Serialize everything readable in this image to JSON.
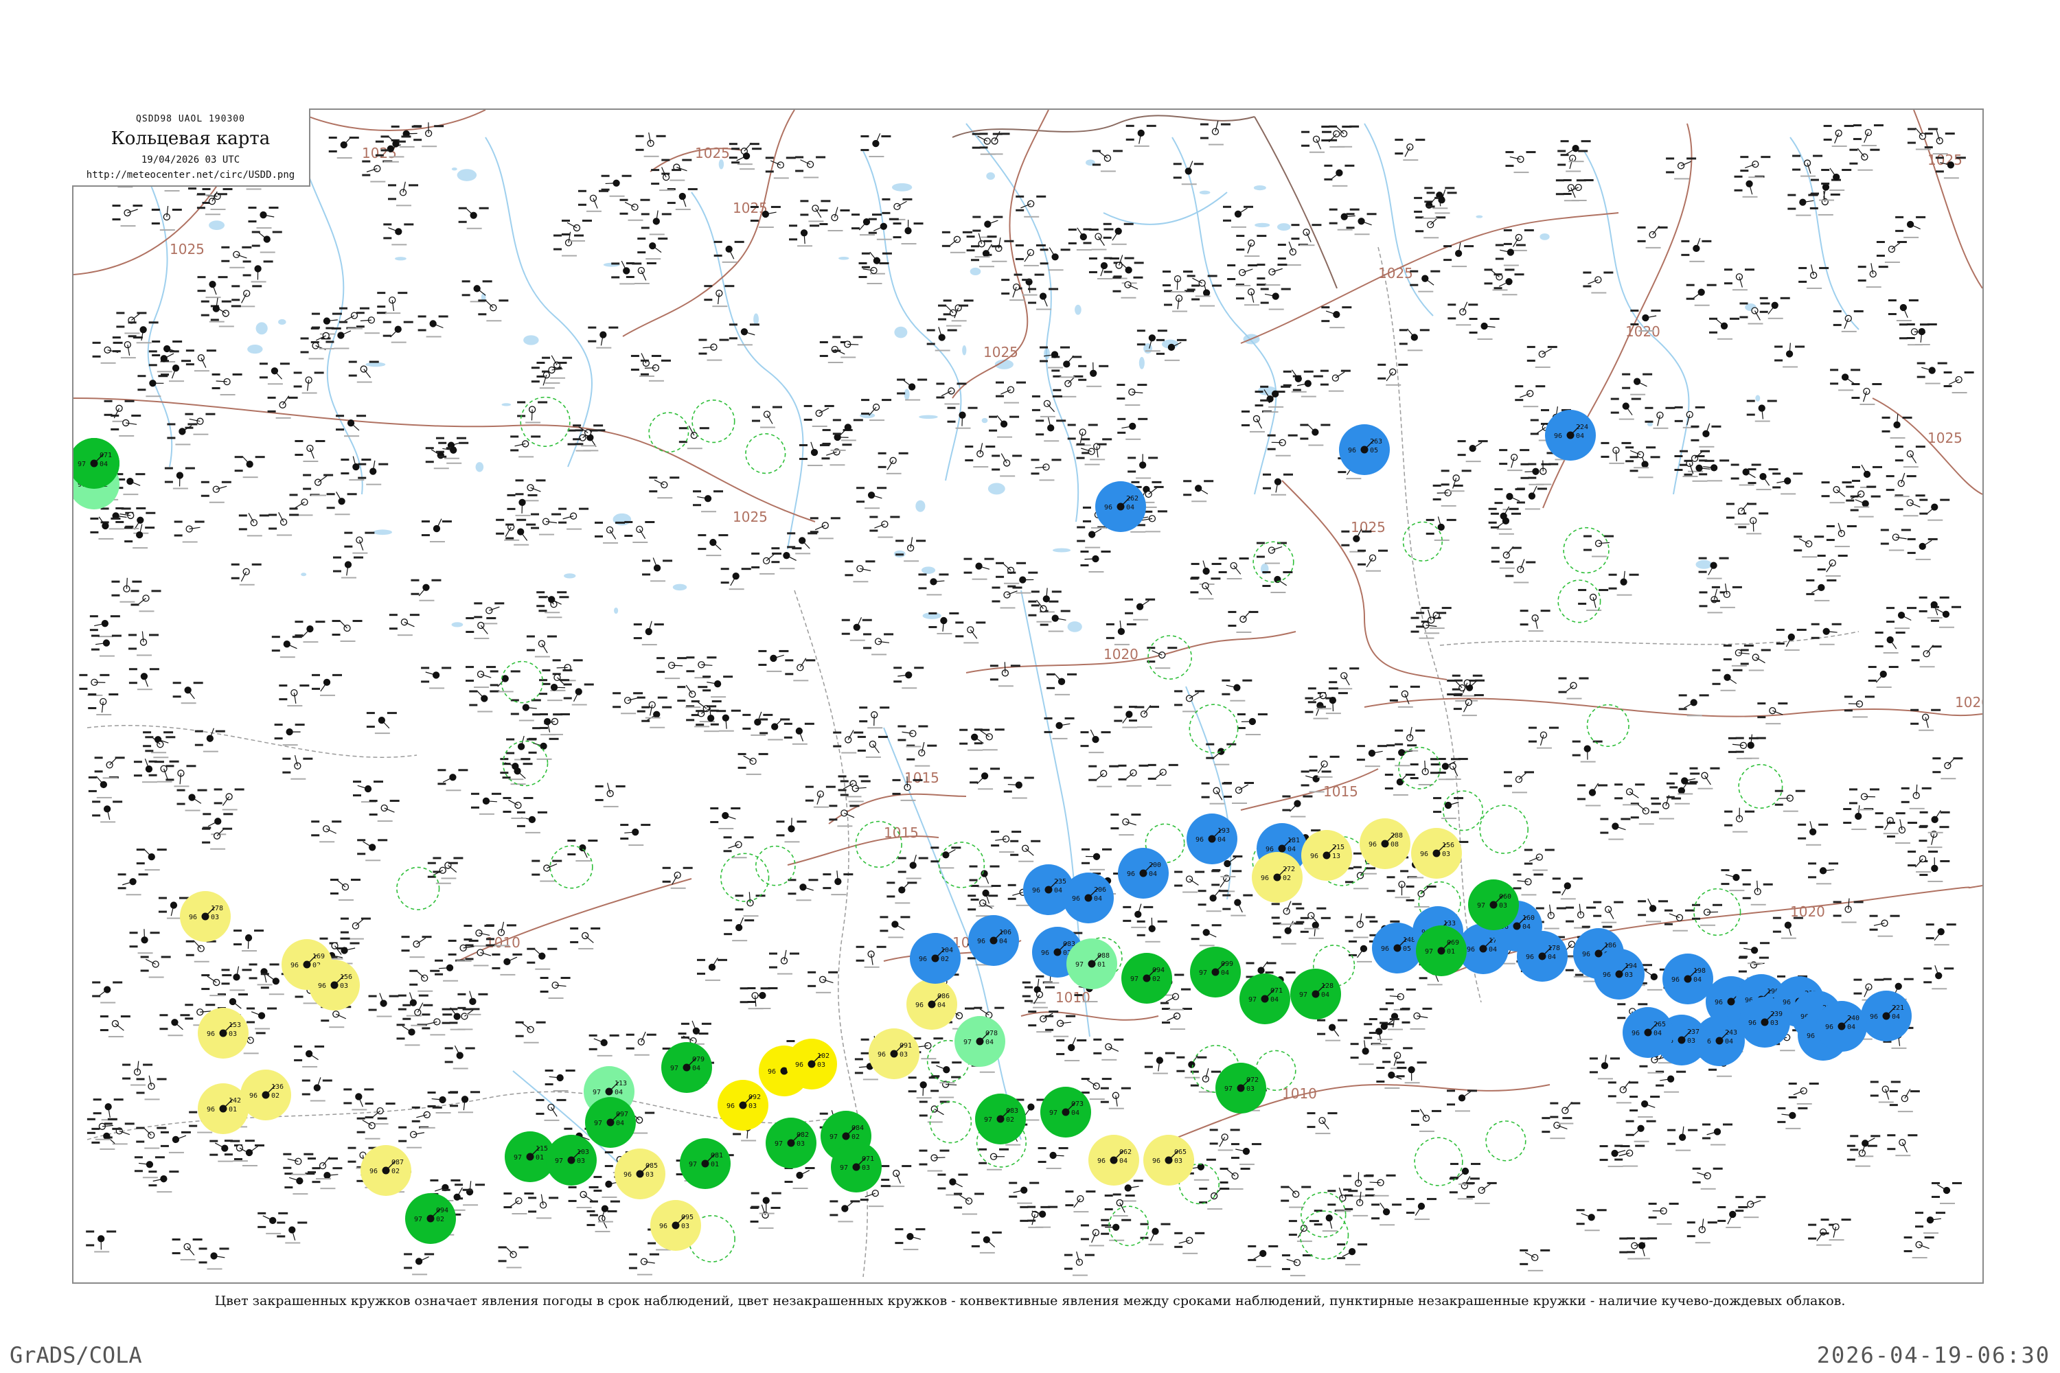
{
  "header": {
    "code": "QSDD98  UAOL  190300",
    "title": "Кольцевая карта",
    "date": "19/04/2026 03 UTC",
    "url": "http://meteocenter.net/circ/USDD.png"
  },
  "caption": "Цвет закрашенных кружков означает явления погоды в срок наблюдений, цвет незакрашенных кружков - конвективные явления между сроками наблюдений, пунктирные незакрашенные кружки - наличие кучево-дождевых облаков.",
  "footer": {
    "left": "GrADS/COLA",
    "right": "2026-04-19-06:30"
  },
  "colors": {
    "rain": "#0bbd2a",
    "light_rain": "#7df2a0",
    "snow": "#2e8de8",
    "fog_haze": "#f5f07a",
    "drizzle": "#fbf000",
    "isobar": "#b07262",
    "river": "#9fd0ee",
    "border": "#c0c0c0",
    "dashed_cb": "#2fbf3a"
  },
  "isobars": [
    {
      "label": "1025"
    },
    {
      "label": "1025"
    },
    {
      "label": "1025"
    },
    {
      "label": "1025"
    },
    {
      "label": "1025"
    },
    {
      "label": "1025"
    },
    {
      "label": "1025"
    },
    {
      "label": "1025"
    },
    {
      "label": "1025"
    },
    {
      "label": "1025"
    },
    {
      "label": "1020"
    },
    {
      "label": "1020"
    },
    {
      "label": "1020"
    },
    {
      "label": "1020"
    },
    {
      "label": "1015"
    },
    {
      "label": "1015"
    },
    {
      "label": "1015"
    },
    {
      "label": "1010"
    },
    {
      "label": "1010"
    },
    {
      "label": "1010"
    },
    {
      "label": "1010"
    }
  ],
  "stations": [
    {
      "id": "s1",
      "type": "rain",
      "p": "137",
      "t": "04",
      "d": "97",
      "name": ""
    },
    {
      "id": "s2",
      "type": "light_rain",
      "p": "160",
      "t": "02",
      "d": "97",
      "name": ""
    },
    {
      "id": "s3",
      "type": "fog_haze",
      "p": "178",
      "t": "03",
      "d": "96",
      "name": ""
    },
    {
      "id": "s4",
      "type": "fog_haze",
      "p": "169",
      "t": "02",
      "d": "96",
      "name": ""
    },
    {
      "id": "s5",
      "type": "fog_haze",
      "p": "156",
      "t": "03",
      "d": "96",
      "name": ""
    },
    {
      "id": "s6",
      "type": "fog_haze",
      "p": "153",
      "t": "03",
      "d": "96",
      "name": ""
    },
    {
      "id": "s7",
      "type": "fog_haze",
      "p": "142",
      "t": "01",
      "d": "96",
      "name": ""
    },
    {
      "id": "s8",
      "type": "fog_haze",
      "p": "136",
      "t": "02",
      "d": "96",
      "name": ""
    },
    {
      "id": "s9",
      "type": "fog_haze",
      "p": "087",
      "t": "02",
      "d": "96",
      "name": ""
    },
    {
      "id": "s10",
      "type": "rain",
      "p": "094",
      "t": "02",
      "d": "97",
      "name": ""
    },
    {
      "id": "s11",
      "type": "rain",
      "p": "115",
      "t": "01",
      "d": "97",
      "name": ""
    },
    {
      "id": "s12",
      "type": "rain",
      "p": "103",
      "t": "03",
      "d": "97",
      "name": ""
    },
    {
      "id": "s13",
      "type": "light_rain",
      "p": "113",
      "t": "04",
      "d": "97",
      "name": ""
    },
    {
      "id": "s14",
      "type": "rain",
      "p": "097",
      "t": "04",
      "d": "97",
      "name": ""
    },
    {
      "id": "s15",
      "type": "fog_haze",
      "p": "085",
      "t": "03",
      "d": "96",
      "name": ""
    },
    {
      "id": "s16",
      "type": "rain",
      "p": "079",
      "t": "04",
      "d": "97",
      "name": ""
    },
    {
      "id": "s17",
      "type": "fog_haze",
      "p": "095",
      "t": "03",
      "d": "96",
      "name": ""
    },
    {
      "id": "s18",
      "type": "rain",
      "p": "081",
      "t": "01",
      "d": "97",
      "name": ""
    },
    {
      "id": "s19",
      "type": "drizzle",
      "p": "092",
      "t": "03",
      "d": "96",
      "name": ""
    },
    {
      "id": "s20",
      "type": "drizzle",
      "p": "101",
      "t": "03",
      "d": "96",
      "name": ""
    },
    {
      "id": "s21",
      "type": "drizzle",
      "p": "102",
      "t": "03",
      "d": "96",
      "name": ""
    },
    {
      "id": "s22",
      "type": "rain",
      "p": "082",
      "t": "03",
      "d": "97",
      "name": ""
    },
    {
      "id": "s23",
      "type": "rain",
      "p": "084",
      "t": "02",
      "d": "97",
      "name": ""
    },
    {
      "id": "s24",
      "type": "rain",
      "p": "071",
      "t": "03",
      "d": "97",
      "name": ""
    },
    {
      "id": "s25",
      "type": "fog_haze",
      "p": "091",
      "t": "03",
      "d": "96",
      "name": ""
    },
    {
      "id": "s26",
      "type": "light_rain",
      "p": "078",
      "t": "04",
      "d": "97",
      "name": ""
    },
    {
      "id": "s27",
      "type": "fog_haze",
      "p": "086",
      "t": "04",
      "d": "96",
      "name": ""
    },
    {
      "id": "s28",
      "type": "snow",
      "p": "106",
      "t": "04",
      "d": "96",
      "name": ""
    },
    {
      "id": "s29",
      "type": "snow",
      "p": "104",
      "t": "02",
      "d": "96",
      "name": ""
    },
    {
      "id": "s30",
      "type": "snow",
      "p": "083",
      "t": "02",
      "d": "96",
      "name": ""
    },
    {
      "id": "s31",
      "type": "light_rain",
      "p": "088",
      "t": "01",
      "d": "97",
      "name": ""
    },
    {
      "id": "s32",
      "type": "rain",
      "p": "094",
      "t": "02",
      "d": "97",
      "name": ""
    },
    {
      "id": "s33",
      "type": "rain",
      "p": "099",
      "t": "04",
      "d": "97",
      "name": ""
    },
    {
      "id": "s34",
      "type": "rain",
      "p": "071",
      "t": "04",
      "d": "97",
      "name": ""
    },
    {
      "id": "s35",
      "type": "rain",
      "p": "128",
      "t": "04",
      "d": "97",
      "name": ""
    },
    {
      "id": "s36",
      "type": "snow",
      "p": "148",
      "t": "05",
      "d": "96",
      "name": ""
    },
    {
      "id": "s37",
      "type": "snow",
      "p": "133",
      "t": "07",
      "d": "96",
      "name": ""
    },
    {
      "id": "s38",
      "type": "snow",
      "p": "174",
      "t": "04",
      "d": "96",
      "name": ""
    },
    {
      "id": "s39",
      "type": "snow",
      "p": "160",
      "t": "04",
      "d": "96",
      "name": ""
    },
    {
      "id": "s40",
      "type": "snow",
      "p": "178",
      "t": "04",
      "d": "96",
      "name": ""
    },
    {
      "id": "s41",
      "type": "snow",
      "p": "186",
      "t": "03",
      "d": "96",
      "name": ""
    },
    {
      "id": "s42",
      "type": "snow",
      "p": "194",
      "t": "03",
      "d": "96",
      "name": ""
    },
    {
      "id": "s43",
      "type": "snow",
      "p": "198",
      "t": "04",
      "d": "96",
      "name": ""
    },
    {
      "id": "s44",
      "type": "snow",
      "p": "173",
      "t": "03",
      "d": "96",
      "name": ""
    },
    {
      "id": "s45",
      "type": "snow",
      "p": "190",
      "t": "04",
      "d": "96",
      "name": ""
    },
    {
      "id": "s46",
      "type": "snow",
      "p": "215",
      "t": "04",
      "d": "96",
      "name": ""
    },
    {
      "id": "s47",
      "type": "snow",
      "p": "225",
      "t": "04",
      "d": "96",
      "name": ""
    },
    {
      "id": "s48",
      "type": "snow",
      "p": "221",
      "t": "04",
      "d": "96",
      "name": ""
    },
    {
      "id": "s49",
      "type": "snow",
      "p": "232",
      "t": "04",
      "d": "96",
      "name": ""
    },
    {
      "id": "s50",
      "type": "snow",
      "p": "240",
      "t": "04",
      "d": "96",
      "name": ""
    },
    {
      "id": "s51",
      "type": "snow",
      "p": "239",
      "t": "03",
      "d": "96",
      "name": ""
    },
    {
      "id": "s52",
      "type": "snow",
      "p": "243",
      "t": "04",
      "d": "96",
      "name": ""
    },
    {
      "id": "s53",
      "type": "snow",
      "p": "237",
      "t": "03",
      "d": "96",
      "name": ""
    },
    {
      "id": "s54",
      "type": "snow",
      "p": "265",
      "t": "04",
      "d": "96",
      "name": ""
    },
    {
      "id": "s55",
      "type": "snow",
      "p": "262",
      "t": "04",
      "d": "96",
      "name": ""
    },
    {
      "id": "s56",
      "type": "snow",
      "p": "263",
      "t": "05",
      "d": "96",
      "name": ""
    },
    {
      "id": "s57",
      "type": "snow",
      "p": "224",
      "t": "04",
      "d": "96",
      "name": ""
    },
    {
      "id": "s58",
      "type": "snow",
      "p": "235",
      "t": "04",
      "d": "96",
      "name": ""
    },
    {
      "id": "s59",
      "type": "snow",
      "p": "206",
      "t": "04",
      "d": "96",
      "name": ""
    },
    {
      "id": "s60",
      "type": "snow",
      "p": "200",
      "t": "04",
      "d": "96",
      "name": ""
    },
    {
      "id": "s61",
      "type": "snow",
      "p": "193",
      "t": "04",
      "d": "96",
      "name": ""
    },
    {
      "id": "s62",
      "type": "snow",
      "p": "181",
      "t": "04",
      "d": "96",
      "name": ""
    },
    {
      "id": "s63",
      "type": "fog_haze",
      "p": "272",
      "t": "02",
      "d": "96",
      "name": ""
    },
    {
      "id": "s64",
      "type": "fog_haze",
      "p": "215",
      "t": "13",
      "d": "96",
      "name": ""
    },
    {
      "id": "s65",
      "type": "fog_haze",
      "p": "288",
      "t": "08",
      "d": "96",
      "name": ""
    },
    {
      "id": "s66",
      "type": "fog_haze",
      "p": "156",
      "t": "03",
      "d": "96",
      "name": ""
    },
    {
      "id": "s67",
      "type": "rain",
      "p": "060",
      "t": "03",
      "d": "97",
      "name": ""
    },
    {
      "id": "s68",
      "type": "rain",
      "p": "069",
      "t": "01",
      "d": "97",
      "name": ""
    },
    {
      "id": "s69",
      "type": "rain",
      "p": "072",
      "t": "03",
      "d": "97",
      "name": ""
    },
    {
      "id": "s70",
      "type": "fog_haze",
      "p": "062",
      "t": "04",
      "d": "96",
      "name": ""
    },
    {
      "id": "s71",
      "type": "fog_haze",
      "p": "065",
      "t": "03",
      "d": "96",
      "name": ""
    },
    {
      "id": "s72",
      "type": "rain",
      "p": "073",
      "t": "04",
      "d": "97",
      "name": ""
    },
    {
      "id": "s73",
      "type": "rain",
      "p": "083",
      "t": "02",
      "d": "97",
      "name": ""
    },
    {
      "id": "s74",
      "type": "rain",
      "p": "071",
      "t": "04",
      "d": "97",
      "name": ""
    }
  ],
  "dashed_cb_count": 42,
  "background_station_count": 900
}
